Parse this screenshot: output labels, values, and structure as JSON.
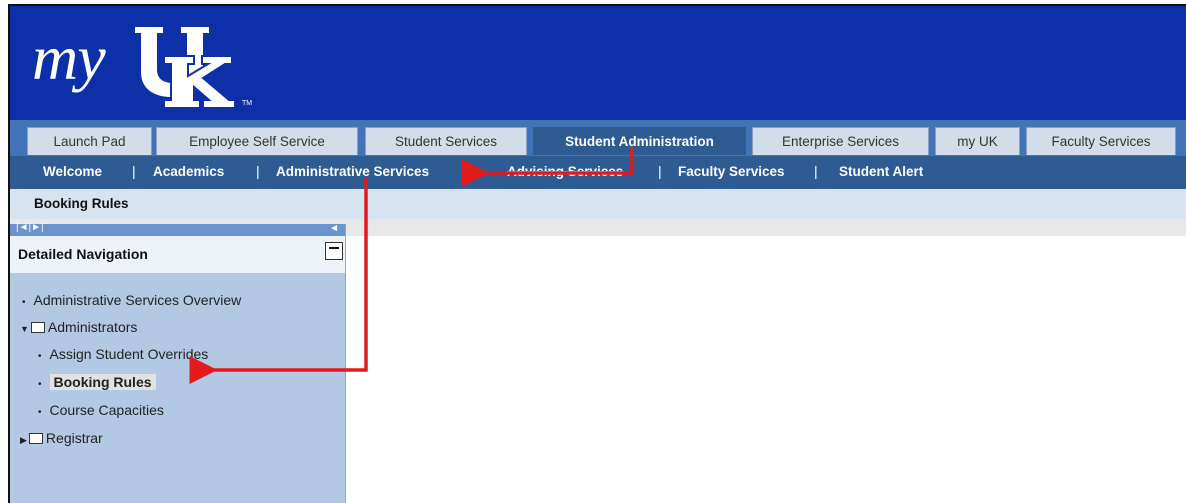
{
  "logo": {
    "text": "my",
    "letters": "UK",
    "trademark": "TM"
  },
  "tabs": [
    {
      "label": "Launch Pad"
    },
    {
      "label": "Employee Self Service"
    },
    {
      "label": "Student Services"
    },
    {
      "label": "Student Administration"
    },
    {
      "label": "Enterprise Services"
    },
    {
      "label": "my UK"
    },
    {
      "label": "Faculty Services"
    }
  ],
  "subnav": [
    {
      "label": "Welcome"
    },
    {
      "label": "Academics"
    },
    {
      "label": "Administrative Services"
    },
    {
      "label": "Advising Services"
    },
    {
      "label": "Faculty Services"
    },
    {
      "label": "Student Alert"
    }
  ],
  "breadcrumb": "Booking Rules",
  "sidebar": {
    "scroll_left": "|◄|►|",
    "scroll_right": "◄",
    "title": "Detailed Navigation",
    "items": [
      {
        "label": "Administrative Services Overview"
      },
      {
        "label": "Administrators"
      },
      {
        "label": "Assign Student Overrides"
      },
      {
        "label": "Booking Rules"
      },
      {
        "label": "Course Capacities"
      },
      {
        "label": "Registrar"
      }
    ]
  },
  "colors": {
    "header": "#0d30a8",
    "tabbar": "#4272b7",
    "subnav": "#2d5b92",
    "arrow": "#e11b1b"
  }
}
